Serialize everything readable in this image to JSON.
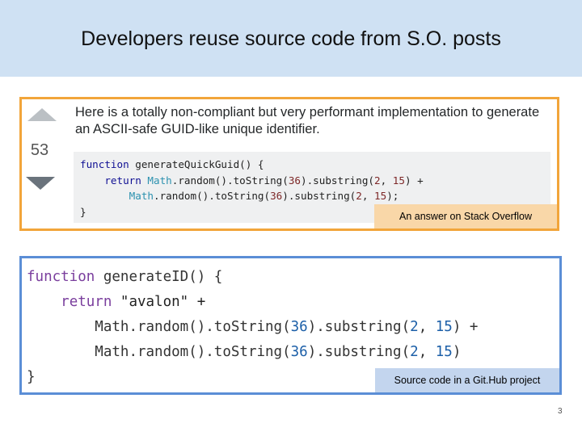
{
  "slide": {
    "title": "Developers reuse source code from S.O. posts",
    "page_number": "3"
  },
  "stackoverflow": {
    "vote_count": "53",
    "answer_text": "Here is a totally non-compliant but very performant implementation to generate an ASCII-safe GUID-like unique identifier.",
    "code": {
      "l1_kw": "function",
      "l1_rest": " generateQuickGuid() {",
      "l2_indent": "    ",
      "l2_kw": "return",
      "l2_obj": " Math",
      "l2_a": ".random().toString(",
      "l2_n1": "36",
      "l2_b": ").substring(",
      "l2_n2": "2",
      "l2_c": ", ",
      "l2_n3": "15",
      "l2_d": ") +",
      "l3_indent": "        ",
      "l3_obj": "Math",
      "l3_a": ".random().toString(",
      "l3_n1": "36",
      "l3_b": ").substring(",
      "l3_n2": "2",
      "l3_c": ", ",
      "l3_n3": "15",
      "l3_d": ");",
      "l4": "}"
    },
    "caption": "An answer on Stack Overflow",
    "colors": {
      "border": "#f2a53a",
      "caption_bg": "#f9d7a8"
    }
  },
  "github": {
    "code": {
      "l1_kw": "function",
      "l1_rest": " generateID() {",
      "l2_indent": "    ",
      "l2_kw": "return",
      "l2_str": " \"avalon\" +",
      "l3_indent": "        ",
      "l3_a": "Math.random().toString(",
      "l3_n1": "36",
      "l3_b": ").substring(",
      "l3_n2": "2",
      "l3_c": ", ",
      "l3_n3": "15",
      "l3_d": ") +",
      "l4_indent": "        ",
      "l4_a": "Math.random().toString(",
      "l4_n1": "36",
      "l4_b": ").substring(",
      "l4_n2": "2",
      "l4_c": ", ",
      "l4_n3": "15",
      "l4_d": ")",
      "l5": "}"
    },
    "caption": "Source code in a Git.Hub project",
    "colors": {
      "border": "#5b8ed6",
      "caption_bg": "#c3d5ee"
    }
  }
}
